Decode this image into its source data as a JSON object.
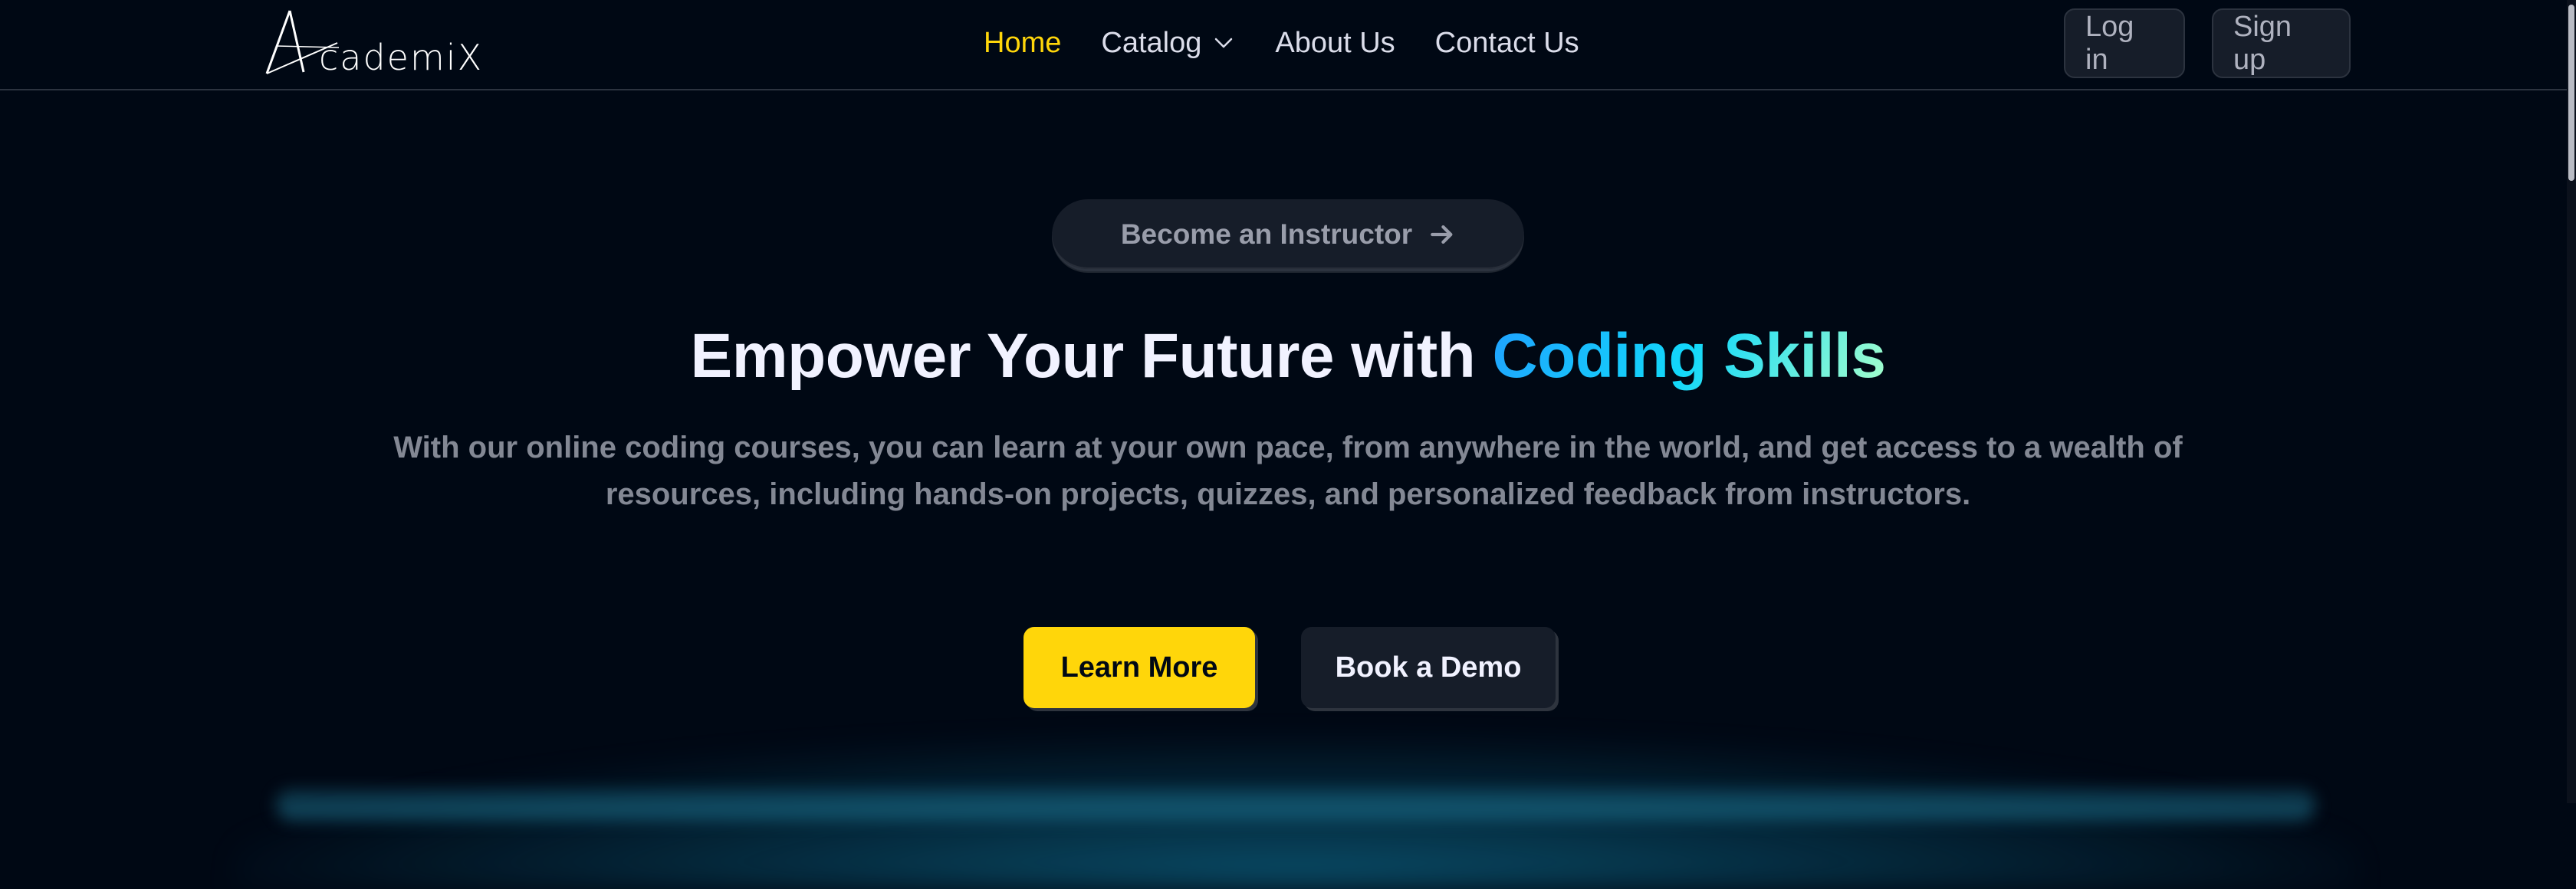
{
  "brand": {
    "name": "cademiX",
    "logo_icon": "stylized-A-star-icon"
  },
  "nav": {
    "items": [
      {
        "label": "Home",
        "active": true
      },
      {
        "label": "Catalog",
        "has_dropdown": true
      },
      {
        "label": "About Us"
      },
      {
        "label": "Contact Us"
      }
    ],
    "login_label": "Log in",
    "signup_label": "Sign up"
  },
  "hero": {
    "instructor_label": "Become an Instructor",
    "headline_prefix": "Empower Your Future with",
    "headline_highlight": "Coding Skills",
    "subtext": "With our online coding courses, you can learn at your own pace, from anywhere in the world, and get access to a wealth of resources, including hands-on projects, quizzes, and personalized feedback from instructors.",
    "learn_more_label": "Learn More",
    "book_demo_label": "Book a Demo"
  },
  "colors": {
    "background": "#000814",
    "accent_yellow": "#ffd60a",
    "gradient_blue": "#12d8fa",
    "button_dark": "#161d29"
  }
}
